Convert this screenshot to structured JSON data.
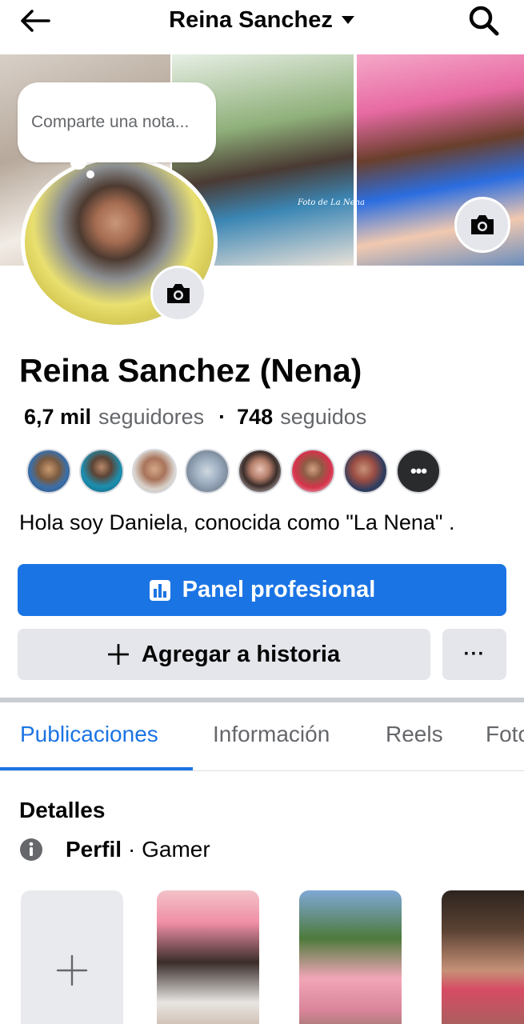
{
  "header": {
    "title": "Reina Sanchez",
    "back_icon": "arrow-left-icon",
    "dropdown_icon": "caret-down-icon",
    "search_icon": "search-icon"
  },
  "cover": {
    "watermark": "Foto de La Nena",
    "camera_icon": "camera-icon"
  },
  "note": {
    "placeholder": "Comparte una nota..."
  },
  "profile": {
    "name": "Reina Sanchez (Nena)",
    "followers_count": "6,7 mil",
    "followers_label": "seguidores",
    "separator": "·",
    "following_count": "748",
    "following_label": "seguidos",
    "bio": "Hola soy Daniela, conocida como \"La Nena\" .",
    "friends_more": "•••"
  },
  "actions": {
    "primary_label": "Panel profesional",
    "secondary_label": "Agregar a historia",
    "more_label": "···"
  },
  "tabs": [
    {
      "label": "Publicaciones",
      "active": true
    },
    {
      "label": "Información",
      "active": false
    },
    {
      "label": "Reels",
      "active": false
    },
    {
      "label": "Fotos",
      "active": false
    }
  ],
  "details": {
    "title": "Detalles",
    "row_label": "Perfil",
    "row_value": "· Gamer"
  },
  "colors": {
    "accent": "#1b74e4",
    "secondary_button": "#e4e6eb",
    "muted_text": "#65676b"
  }
}
